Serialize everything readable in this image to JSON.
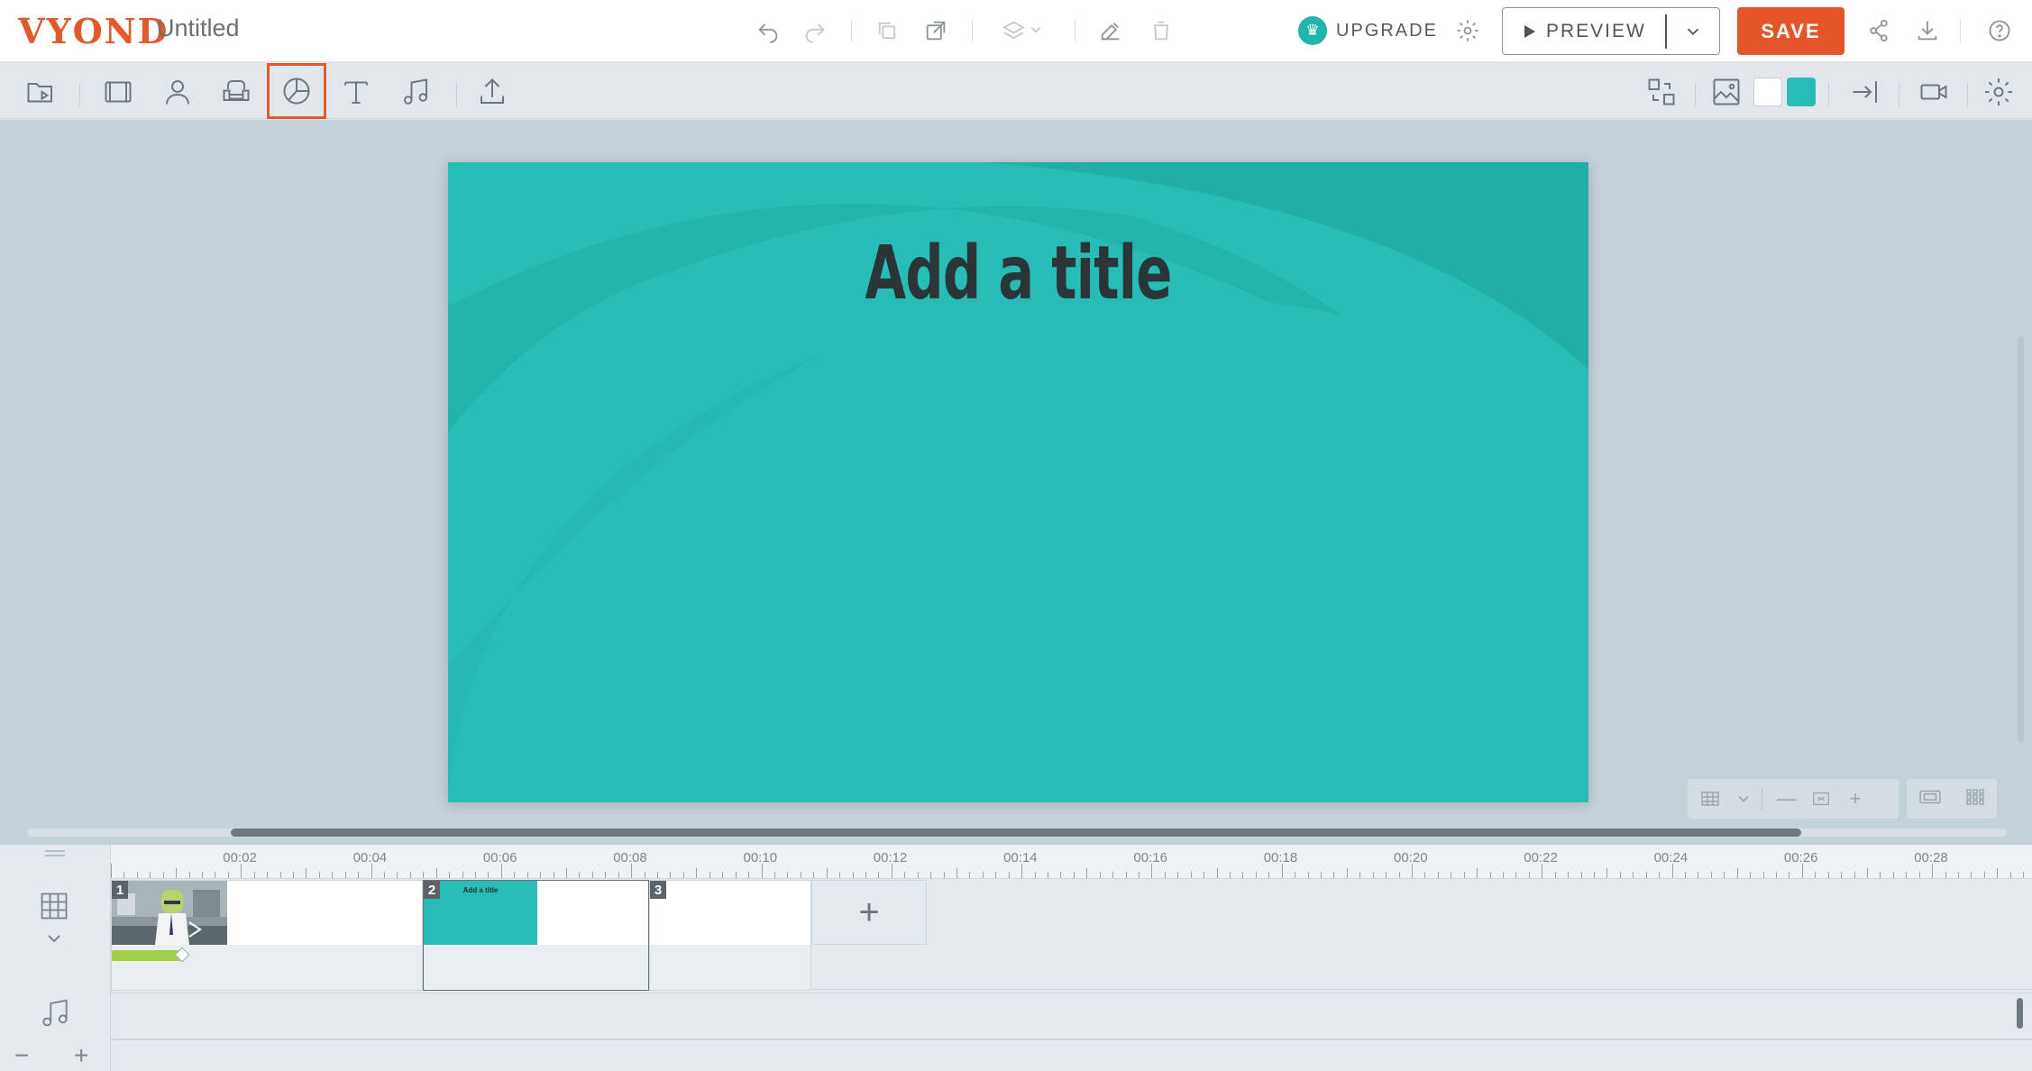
{
  "app": {
    "logo": "VYOND",
    "document_title": "Untitled"
  },
  "header": {
    "upgrade_label": "UPGRADE",
    "preview_label": "PREVIEW",
    "save_label": "SAVE"
  },
  "toolbar": {
    "tools": [
      "video-templates",
      "scenes",
      "characters",
      "props",
      "charts",
      "text",
      "audio",
      "upload"
    ],
    "active_tool": "charts",
    "swatch_colors": [
      "#ffffff",
      "#27bcb6"
    ]
  },
  "canvas": {
    "title": "Add a title",
    "background_color": "#27bcb6"
  },
  "timeline": {
    "ruler_labels": [
      "00:02",
      "00:04",
      "00:06",
      "00:08",
      "00:10",
      "00:12",
      "00:14",
      "00:16",
      "00:18",
      "00:20",
      "00:22",
      "00:24",
      "00:26",
      "00:28"
    ],
    "scenes": [
      {
        "number": "1"
      },
      {
        "number": "2",
        "thumb_text": "Add a title"
      },
      {
        "number": "3"
      }
    ],
    "add_scene_label": "+"
  },
  "colors": {
    "brand": "#e05a2b",
    "save": "#e4562a",
    "accent": "#1fb5ad"
  }
}
